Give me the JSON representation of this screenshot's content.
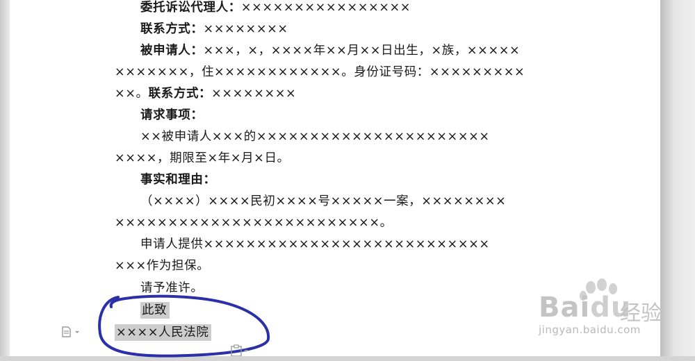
{
  "document": {
    "lines": [
      {
        "label": "委托诉讼代理人：",
        "text": "××××××××××××××××"
      },
      {
        "label": "联系方式：",
        "text": "××××××××"
      },
      {
        "label": "被申请人：",
        "text": "×××，×，××××年××月××日出生，×族，×××××"
      },
      {
        "text": "×××××××，住××××××××××××。身份证号码：×××××××××"
      },
      {
        "text": "××。",
        "label": "联系方式：",
        "text2": "××××××××"
      },
      {
        "label": "请求事项："
      },
      {
        "text": "××被申请人×××的××××××××××××××××××××××"
      },
      {
        "text": "××××，期限至×年×月×日。"
      },
      {
        "label": "事实和理由："
      },
      {
        "text": "（××××）××××民初××××号×××××一案，××××××××"
      },
      {
        "text": "×××××××××××××××××××××××××。"
      },
      {
        "text": "申请人提供×××××××××××××××××××××××××××"
      },
      {
        "text": "×××作为担保。"
      },
      {
        "text": "请予准许。"
      },
      {
        "text": "此致"
      },
      {
        "text": "××××人民法院"
      }
    ]
  },
  "watermark": {
    "brand_a": "Bai",
    "brand_b": "du",
    "brand_cn": "经验",
    "url": "jingyan.baidu.com"
  },
  "icons": {
    "paste_options": "paste-options-icon",
    "paste_options_2": "paste-options-icon"
  },
  "annotation_color": "#2b2fa8"
}
